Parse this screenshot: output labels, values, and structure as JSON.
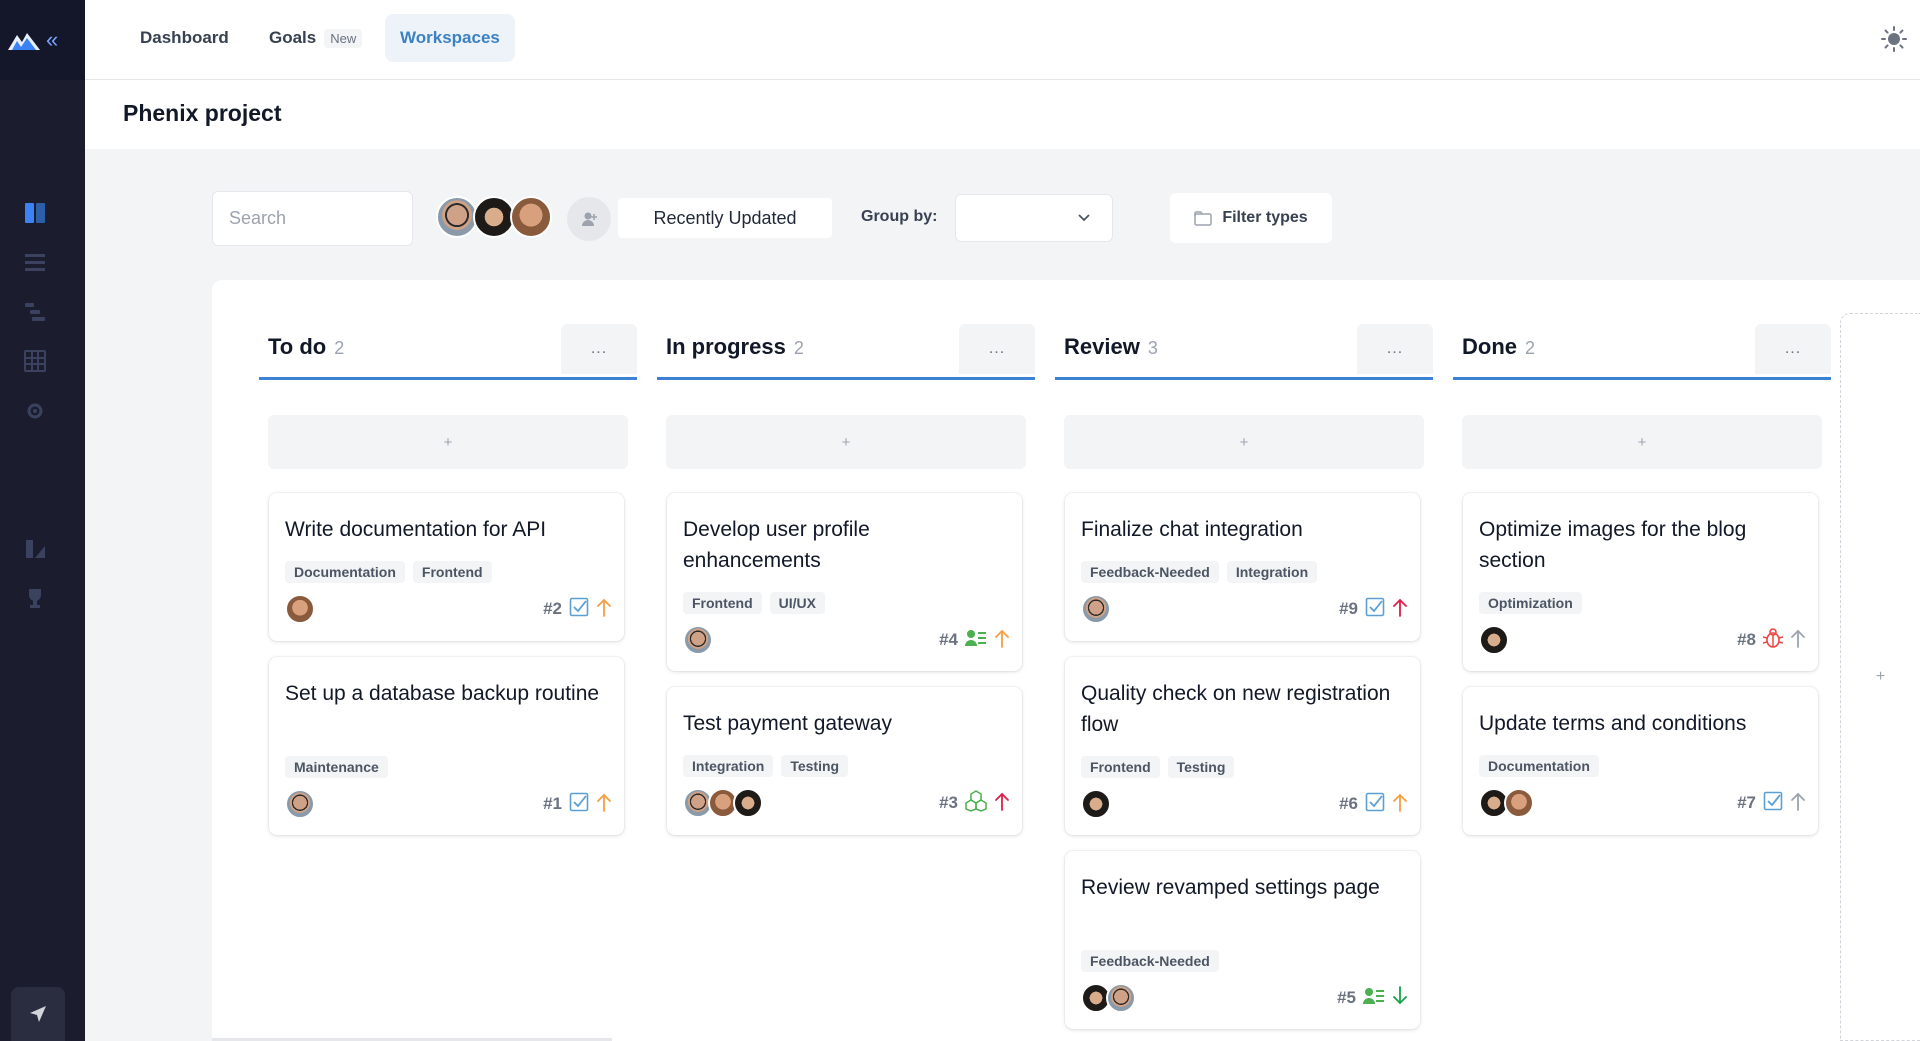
{
  "nav": {
    "dashboard": "Dashboard",
    "goals": "Goals",
    "goals_badge": "New",
    "workspaces": "Workspaces"
  },
  "page": {
    "title": "Phenix project"
  },
  "toolbar": {
    "search_placeholder": "Search",
    "sort_label": "Recently Updated",
    "group_by_label": "Group by:",
    "group_by_value": "",
    "filter_label": "Filter types"
  },
  "colors": {
    "accent": "#3b82d6",
    "sidebar_bg": "#1b1d2e",
    "priority_high": "#e11d48",
    "priority_medium": "#f59e42",
    "priority_low": "#16a34a",
    "priority_none": "#9ca3af",
    "task_icon": "#5b9fd4",
    "assign_icon": "#4caf50",
    "bug_icon": "#ef4444"
  },
  "columns": [
    {
      "title": "To do",
      "count": "2",
      "menu": "...",
      "add": "+",
      "cards": [
        {
          "title": "Write documentation for API",
          "tags": [
            "Documentation",
            "Frontend"
          ],
          "number": "#2",
          "type_icon": "task-icon",
          "priority_icon": "arrow-up-medium-icon",
          "assignees": [
            "avatar-brown"
          ]
        },
        {
          "title": "Set up a database backup routine",
          "tags": [
            "Maintenance"
          ],
          "number": "#1",
          "type_icon": "task-icon",
          "priority_icon": "arrow-up-medium-icon",
          "assignees": [
            "avatar-glasses"
          ]
        }
      ]
    },
    {
      "title": "In progress",
      "count": "2",
      "menu": "...",
      "add": "+",
      "cards": [
        {
          "title": "Develop user profile enhancements",
          "tags": [
            "Frontend",
            "UI/UX"
          ],
          "number": "#4",
          "type_icon": "user-story-icon",
          "priority_icon": "arrow-up-medium-icon",
          "assignees": [
            "avatar-glasses"
          ]
        },
        {
          "title": "Test payment gateway",
          "tags": [
            "Integration",
            "Testing"
          ],
          "number": "#3",
          "type_icon": "epic-icon",
          "priority_icon": "arrow-up-high-icon",
          "assignees": [
            "avatar-glasses",
            "avatar-brown",
            "avatar-woman"
          ]
        }
      ]
    },
    {
      "title": "Review",
      "count": "3",
      "menu": "...",
      "add": "+",
      "cards": [
        {
          "title": "Finalize chat integration",
          "tags": [
            "Feedback-Needed",
            "Integration"
          ],
          "number": "#9",
          "type_icon": "task-icon",
          "priority_icon": "arrow-up-high-icon",
          "assignees": [
            "avatar-glasses"
          ]
        },
        {
          "title": "Quality check on new registration flow",
          "tags": [
            "Frontend",
            "Testing"
          ],
          "number": "#6",
          "type_icon": "task-icon",
          "priority_icon": "arrow-up-medium-icon",
          "assignees": [
            "avatar-woman"
          ]
        },
        {
          "title": "Review revamped settings page",
          "tags": [
            "Feedback-Needed"
          ],
          "number": "#5",
          "type_icon": "user-story-icon",
          "priority_icon": "arrow-down-low-icon",
          "assignees": [
            "avatar-woman",
            "avatar-glasses"
          ]
        }
      ]
    },
    {
      "title": "Done",
      "count": "2",
      "menu": "...",
      "add": "+",
      "cards": [
        {
          "title": "Optimize images for the blog section",
          "tags": [
            "Optimization"
          ],
          "number": "#8",
          "type_icon": "bug-icon",
          "priority_icon": "arrow-up-none-icon",
          "assignees": [
            "avatar-woman"
          ]
        },
        {
          "title": "Update terms and conditions",
          "tags": [
            "Documentation"
          ],
          "number": "#7",
          "type_icon": "task-icon",
          "priority_icon": "arrow-up-none-icon",
          "assignees": [
            "avatar-woman",
            "avatar-brown"
          ]
        }
      ]
    }
  ],
  "new_column": "+"
}
